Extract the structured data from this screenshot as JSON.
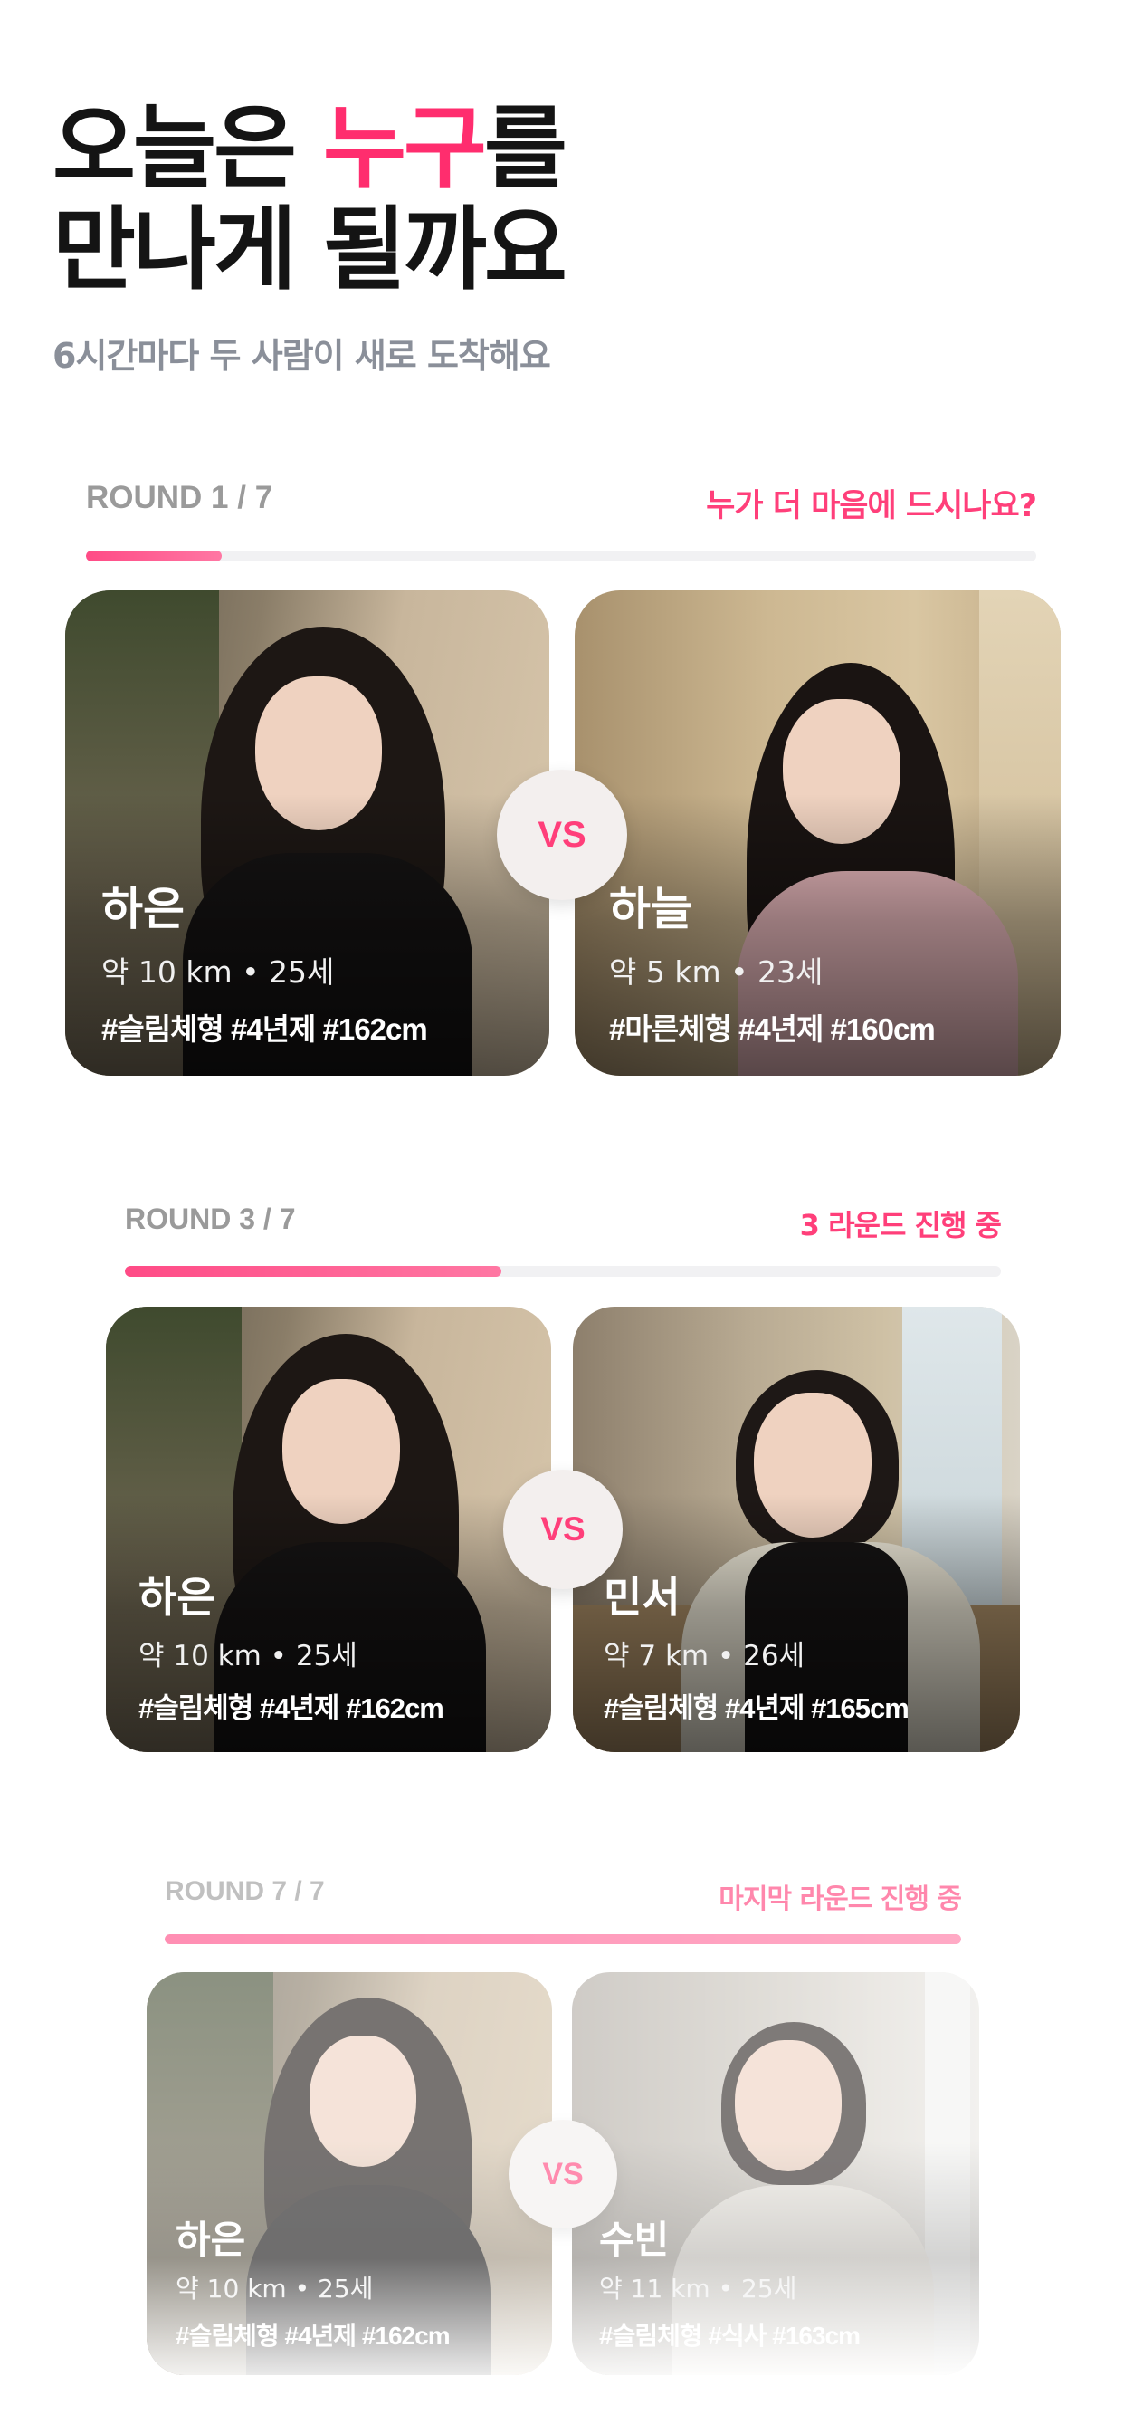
{
  "hero": {
    "title_line1_prefix": "오늘은 ",
    "title_line1_highlight": "누구",
    "title_line1_suffix": "를",
    "title_line2": "만나게 될까요",
    "subtitle": "6시간마다 두 사람이 새로 도착해요"
  },
  "colors": {
    "accent": "#ff2d6e",
    "title": "#141414",
    "subtitle": "#8a8f99"
  },
  "rounds": [
    {
      "label": "ROUND 1 / 7",
      "prompt": "누가 더 마음에 드시나요?",
      "progress": 0.143,
      "vs": "VS",
      "left": {
        "name": "하은",
        "meta": "약 10 km • 25세",
        "tags": "#슬림체형 #4년제 #162cm"
      },
      "right": {
        "name": "하늘",
        "meta": "약 5 km • 23세",
        "tags": "#마른체형 #4년제 #160cm"
      }
    },
    {
      "label": "ROUND 3 / 7",
      "prompt": "3 라운드 진행 중",
      "progress": 0.43,
      "vs": "VS",
      "left": {
        "name": "하은",
        "meta": "약 10 km • 25세",
        "tags": "#슬림체형 #4년제 #162cm"
      },
      "right": {
        "name": "민서",
        "meta": "약 7 km • 26세",
        "tags": "#슬림체형 #4년제 #165cm"
      }
    },
    {
      "label": "ROUND 7 / 7",
      "prompt": "마지막 라운드 진행 중",
      "progress": 1.0,
      "vs": "VS",
      "left": {
        "name": "하은",
        "meta": "약 10 km • 25세",
        "tags": "#슬림체형 #4년제 #162cm"
      },
      "right": {
        "name": "수빈",
        "meta": "약 11 km • 25세",
        "tags": "#슬림체형 #식사 #163cm"
      }
    }
  ]
}
